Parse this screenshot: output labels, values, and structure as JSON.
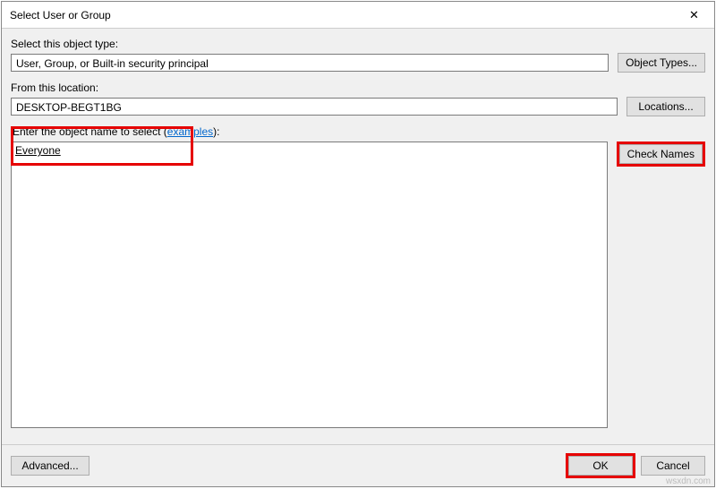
{
  "window": {
    "title": "Select User or Group",
    "close": "✕"
  },
  "objectType": {
    "label": "Select this object type:",
    "value": "User, Group, or Built-in security principal",
    "button": "Object Types..."
  },
  "location": {
    "label": "From this location:",
    "value": "DESKTOP-BEGT1BG",
    "button": "Locations..."
  },
  "objectName": {
    "labelPrefix": "Enter the object name to select (",
    "examplesLink": "examples",
    "labelSuffix": "):",
    "value": "Everyone",
    "button": "Check Names"
  },
  "buttons": {
    "advanced": "Advanced...",
    "ok": "OK",
    "cancel": "Cancel"
  },
  "watermark": "wsxdn.com"
}
